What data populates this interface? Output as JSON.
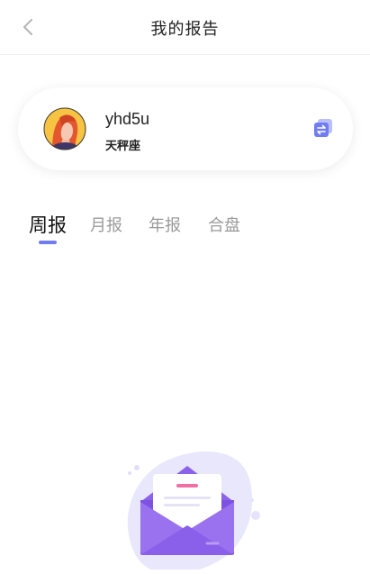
{
  "header": {
    "title": "我的报告",
    "back_icon": "chevron-left-icon"
  },
  "profile": {
    "username": "yhd5u",
    "zodiac_sign": "天秤座",
    "avatar_icon": "avatar-illustration",
    "switch_icon": "swap-arrows-icon",
    "accent_color": "#6f7cf2"
  },
  "tabs": [
    {
      "label": "周报",
      "active": true
    },
    {
      "label": "月报",
      "active": false
    },
    {
      "label": "年报",
      "active": false
    },
    {
      "label": "合盘",
      "active": false
    }
  ],
  "empty_state": {
    "icon": "envelope-letter-icon",
    "primary_color": "#8b63e8"
  }
}
